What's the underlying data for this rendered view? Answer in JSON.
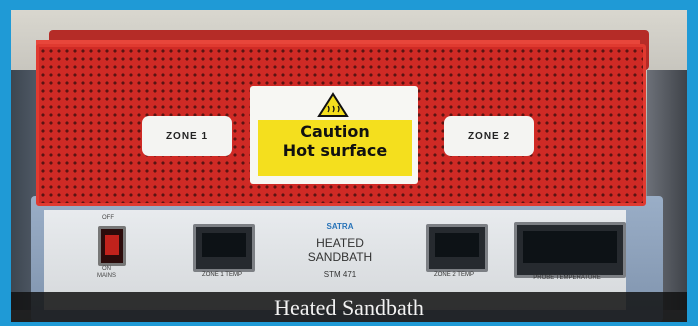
{
  "caption": "Heated Sandbath",
  "basket": {
    "zone1_label": "ZONE 1",
    "zone2_label": "ZONE 2",
    "caution_line1": "Caution",
    "caution_line2": "Hot surface",
    "warning_icon": "hot-surface-warning-icon"
  },
  "panel": {
    "switch_off": "OFF",
    "switch_on": "ON",
    "switch_sub": "MAINS",
    "logo": "SATRA",
    "title_line1": "HEATED",
    "title_line2": "SANDBATH",
    "model": "STM 471",
    "zone1_ctrl": "ZONE 1 TEMP",
    "zone2_ctrl": "ZONE 2 TEMP",
    "probe_ctrl": "PROBE TEMPERATURE"
  },
  "colors": {
    "frame": "#1f9ad6",
    "basket": "#cf2a25",
    "caution_yellow": "#f4df1e"
  }
}
